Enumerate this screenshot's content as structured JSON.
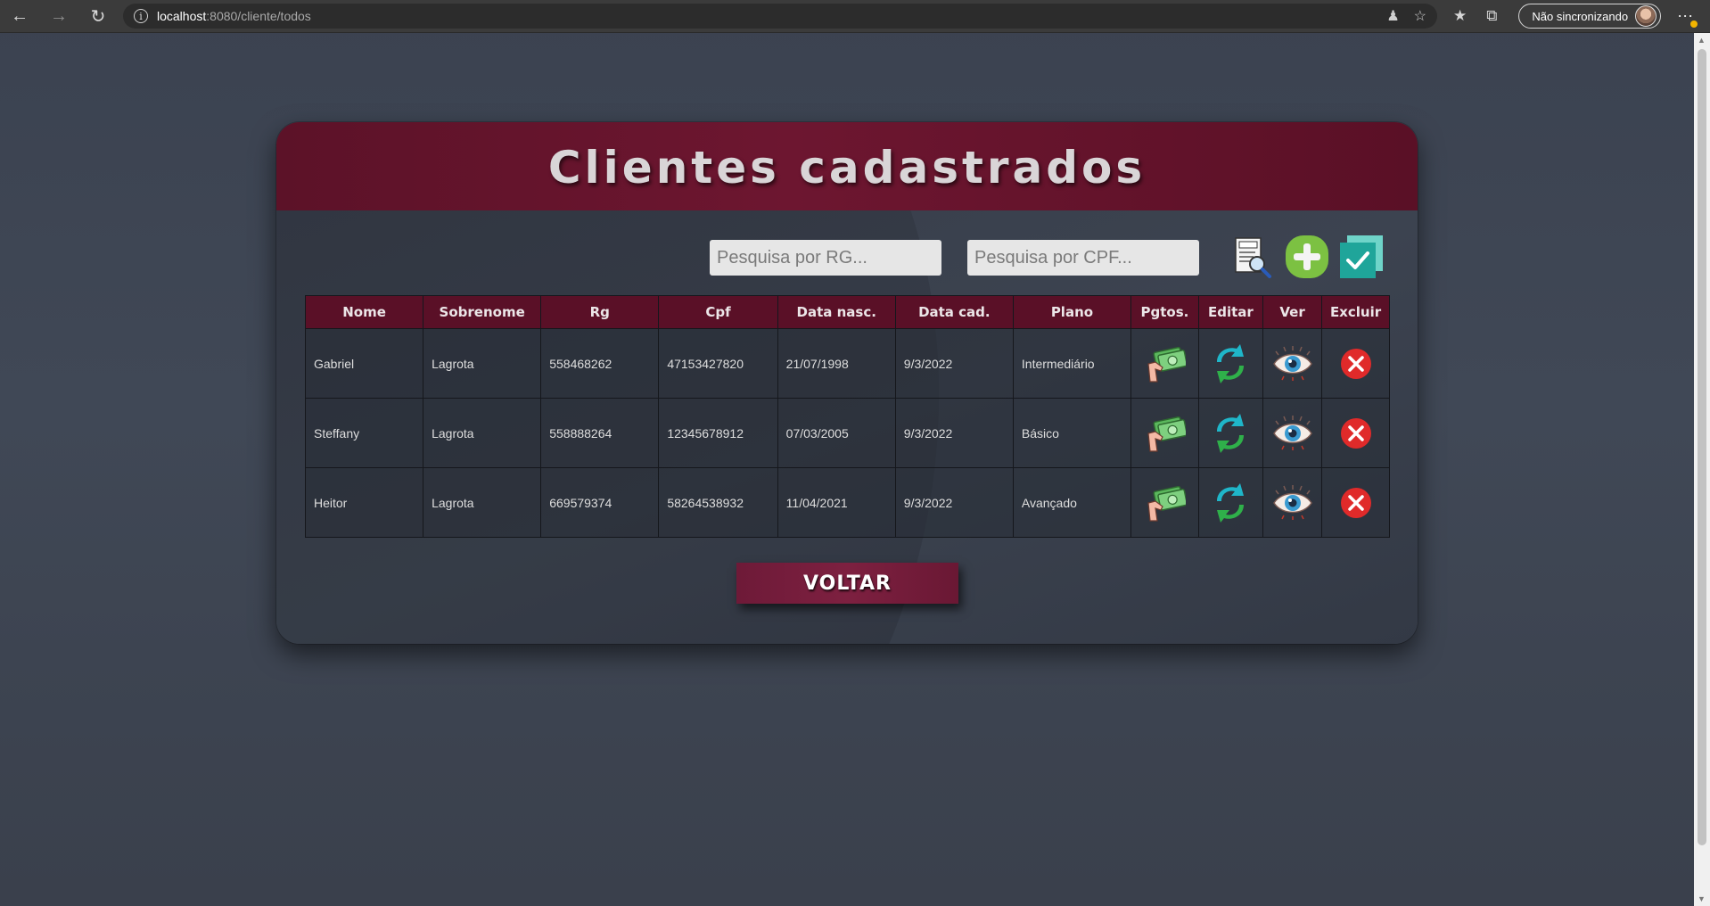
{
  "browser": {
    "url_host": "localhost",
    "url_path": ":8080/cliente/todos",
    "sync_label": "Não sincronizando"
  },
  "page": {
    "title": "Clientes cadastrados",
    "search_rg_placeholder": "Pesquisa por RG...",
    "search_cpf_placeholder": "Pesquisa por CPF...",
    "back_button": "VOLTAR"
  },
  "table": {
    "headers": [
      "Nome",
      "Sobrenome",
      "Rg",
      "Cpf",
      "Data nasc.",
      "Data cad.",
      "Plano",
      "Pgtos.",
      "Editar",
      "Ver",
      "Excluir"
    ],
    "rows": [
      {
        "nome": "Gabriel",
        "sobrenome": "Lagrota",
        "rg": "558468262",
        "cpf": "47153427820",
        "data_nasc": "21/07/1998",
        "data_cad": "9/3/2022",
        "plano": "Intermediário"
      },
      {
        "nome": "Steffany",
        "sobrenome": "Lagrota",
        "rg": "558888264",
        "cpf": "12345678912",
        "data_nasc": "07/03/2005",
        "data_cad": "9/3/2022",
        "plano": "Básico"
      },
      {
        "nome": "Heitor",
        "sobrenome": "Lagrota",
        "rg": "669579374",
        "cpf": "58264538932",
        "data_nasc": "11/04/2021",
        "data_cad": "9/3/2022",
        "plano": "Avançado"
      }
    ]
  },
  "icons": {
    "report": "report-search-icon",
    "add": "add-client-icon",
    "check": "confirm-icon",
    "payments": "money-hand-icon",
    "edit": "refresh-edit-icon",
    "view": "eye-icon",
    "delete": "delete-x-icon"
  },
  "colors": {
    "header_bg": "#5c1228",
    "table_header_bg": "#5a1027",
    "button_bg": "#7d2040",
    "page_bg": "#404856"
  }
}
